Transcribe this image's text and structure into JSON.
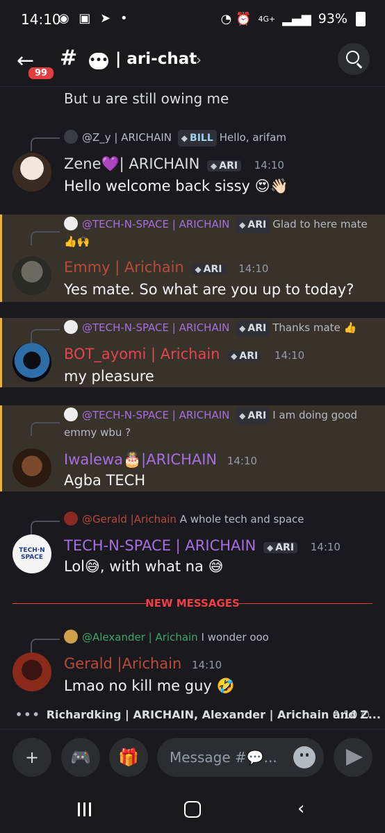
{
  "status_bar": {
    "time": "14:10",
    "battery": "93%",
    "network": "4G+"
  },
  "header": {
    "back_badge": "99",
    "channel_name": "| ari-chat"
  },
  "messages": [
    {
      "id": "m0",
      "text": "But u are still owing me"
    },
    {
      "id": "m1",
      "reply_to": "@Z_y | ARICHAIN",
      "reply_tag": "BILL",
      "reply_text": "Hello, arifam",
      "author": "Zene💜| ARICHAIN",
      "author_color": "#dbdee1",
      "tag": "ARI",
      "time": "14:10",
      "text": "Hello welcome back sissy 😍👋🏻",
      "highlight": false
    },
    {
      "id": "m2",
      "reply_to": "@TECH-N-SPACE | ARICHAIN",
      "reply_tag": "ARI",
      "reply_text": "Glad to here mate 👍🙌",
      "author": "Emmy | Arichain",
      "author_color": "#b94a3a",
      "tag": "ARI",
      "time": "14:10",
      "text": "Yes mate. So what are you up to today?",
      "highlight": true
    },
    {
      "id": "m3",
      "reply_to": "@TECH-N-SPACE | ARICHAIN",
      "reply_tag": "ARI",
      "reply_text": "Thanks mate 👍",
      "author": "BOT_ayomi | Arichain",
      "author_color": "#e8424e",
      "tag": "ARI",
      "time": "14:10",
      "text": "my pleasure",
      "highlight": true
    },
    {
      "id": "m4",
      "reply_to": "@TECH-N-SPACE | ARICHAIN",
      "reply_tag": "ARI",
      "reply_text": "I am doing good emmy wbu ?",
      "author": "Iwalewa🎂|ARICHAIN",
      "author_color": "#a66ee0",
      "tag": "",
      "time": "14:10",
      "text": "Agba TECH",
      "highlight": true
    },
    {
      "id": "m5",
      "reply_to": "@Gerald |Arichain",
      "reply_tag": "",
      "reply_text": "A whole tech and space",
      "author": "TECH-N-SPACE | ARICHAIN",
      "author_color": "#a66ee0",
      "tag": "ARI",
      "time": "14:10",
      "text": "Lol😅,  with what na 😅",
      "highlight": false
    },
    {
      "id": "m6",
      "reply_to": "@Alexander | Arichain",
      "reply_tag": "",
      "reply_text": "I wonder ooo",
      "author": "Gerald |Arichain",
      "author_color": "#b94a3a",
      "tag": "",
      "time": "14:10",
      "text": "Lmao no kill me guy 🤣",
      "highlight": false
    }
  ],
  "new_messages_label": "NEW MESSAGES",
  "typing": {
    "text": "Richardking | ARICHAIN, Alexander | Arichain and Z...",
    "timer": "0:10"
  },
  "composer": {
    "placeholder": "Message #💬..."
  },
  "colors": {
    "background": "#1a1a1e",
    "mention_bg": "#37332b",
    "mention_bar": "#f0b232",
    "new_messages": "#f23f43",
    "reply_link": "#a66ee0"
  }
}
